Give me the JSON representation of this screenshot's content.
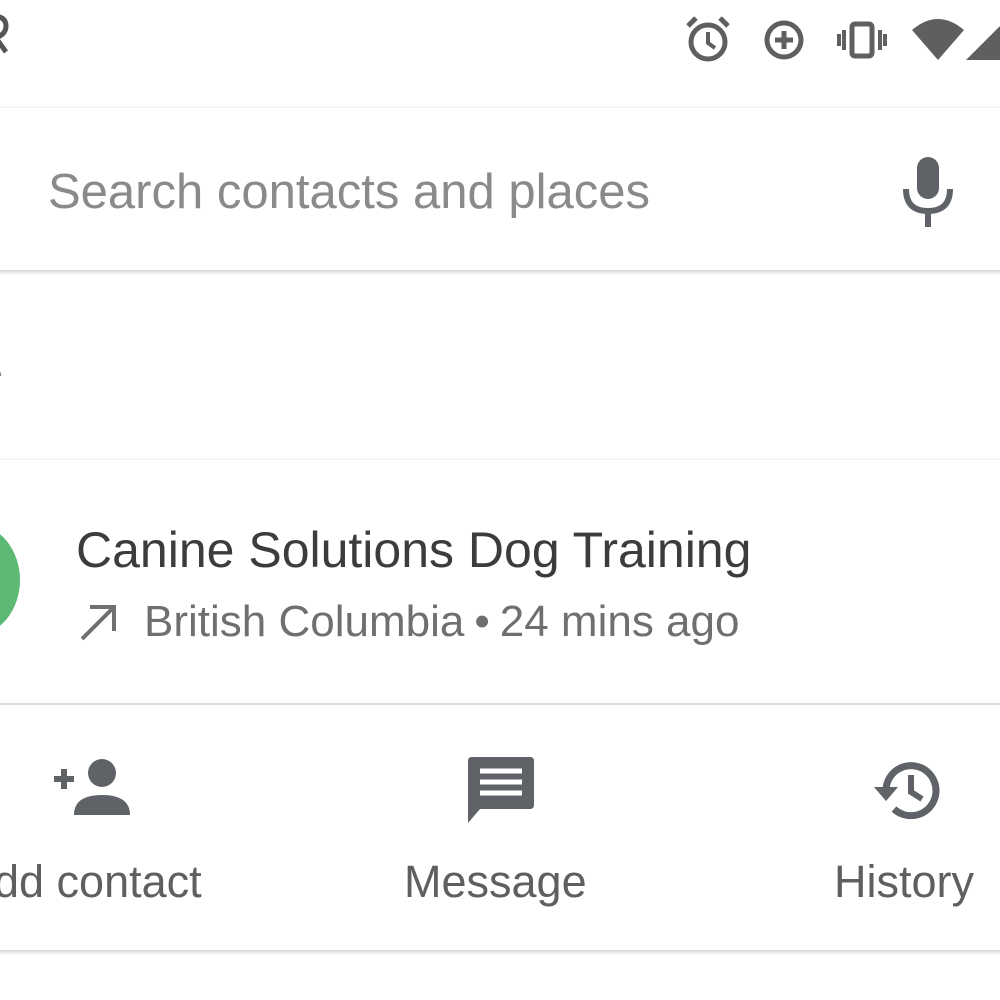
{
  "status_bar": {
    "icons": [
      "alarm-icon",
      "data-saver-icon",
      "vibrate-icon",
      "wifi-icon",
      "cell-signal-icon"
    ]
  },
  "search": {
    "placeholder": "Search contacts and places",
    "mic_icon": "mic-icon"
  },
  "result": {
    "name": "Canine Solutions Dog Training",
    "call_direction_icon": "outgoing-call-icon",
    "location": "British Columbia",
    "separator": "•",
    "time": "24 mins ago",
    "avatar_color": "#5bb974"
  },
  "actions": [
    {
      "label": "dd contact",
      "icon": "add-person-icon"
    },
    {
      "label": "Message",
      "icon": "message-icon"
    },
    {
      "label": "History",
      "icon": "history-icon"
    }
  ],
  "colors": {
    "icon_gray": "#5f6368",
    "text_primary": "#3c3c3c",
    "text_secondary": "#6f6f6f"
  }
}
